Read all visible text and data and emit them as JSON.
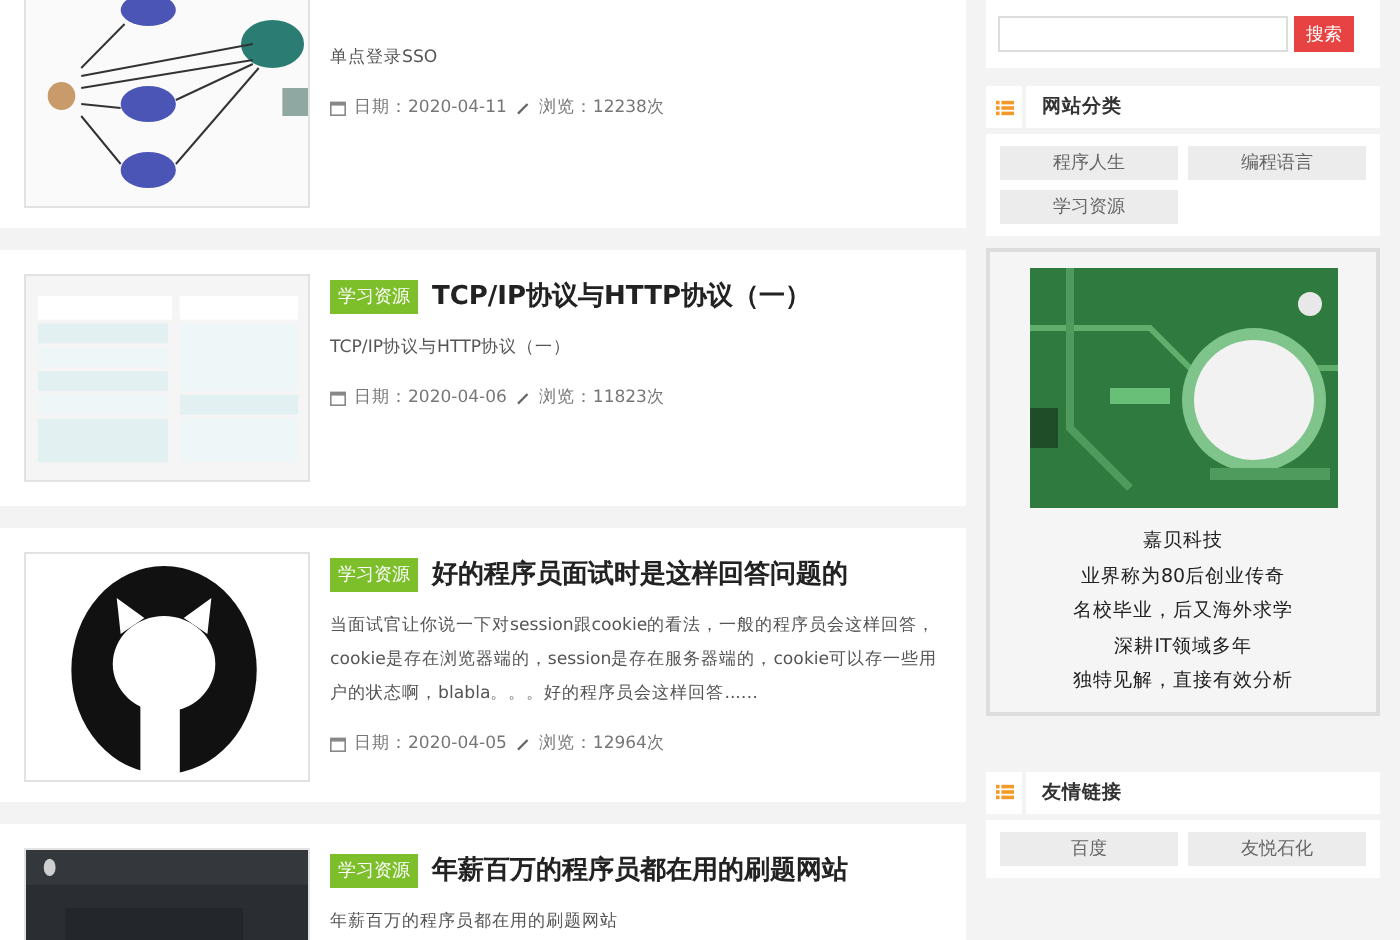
{
  "articles": [
    {
      "summary": "单点登录SSO",
      "date_label": "日期：2020-04-11",
      "views_label": "浏览：12238次"
    },
    {
      "tag": "学习资源",
      "title": "TCP/IP协议与HTTP协议（一）",
      "summary": "TCP/IP协议与HTTP协议（一）",
      "date_label": "日期：2020-04-06",
      "views_label": "浏览：11823次"
    },
    {
      "tag": "学习资源",
      "title": "好的程序员面试时是这样回答问题的",
      "summary": "当面试官让你说一下对session跟cookie的看法，一般的程序员会这样回答，cookie是存在浏览器端的，session是存在服务器端的，cookie可以存一些用户的状态啊，blabla。。。好的程序员会这样回答...…",
      "date_label": "日期：2020-04-05",
      "views_label": "浏览：12964次"
    },
    {
      "tag": "学习资源",
      "title": "年薪百万的程序员都在用的刷题网站",
      "summary": "年薪百万的程序员都在用的刷题网站"
    }
  ],
  "search": {
    "button": "搜索"
  },
  "categories": {
    "title": "网站分类",
    "items": [
      "程序人生",
      "编程语言",
      "学习资源"
    ]
  },
  "ad": {
    "lines": [
      "嘉贝科技",
      "业界称为80后创业传奇",
      "名校毕业，后又海外求学",
      "深耕IT领域多年",
      "独特见解，直接有效分析"
    ]
  },
  "links": {
    "title": "友情链接",
    "items": [
      "百度",
      "友悦石化"
    ]
  }
}
